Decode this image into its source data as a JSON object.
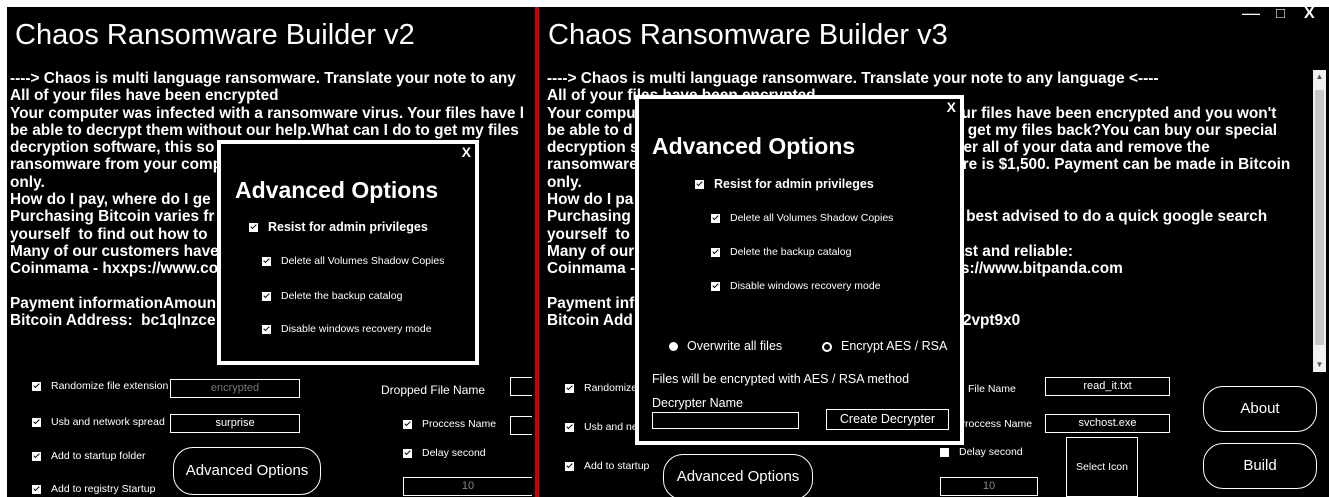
{
  "left": {
    "title": "Chaos Ransomware Builder v2",
    "note_lines": [
      "----> Chaos is multi language ransomware. Translate your note to any",
      "All of your files have been encrypted",
      "Your computer was infected with a ransomware virus. Your files have l",
      "be able to decrypt them without our help.What can I do to get my files",
      "decryption software, this so                                              f your c",
      "ransomware from your comp                                              $1,500.",
      "only.",
      "How do I pay, where do I ge",
      "Purchasing Bitcoin varies fr                                          t advise",
      "yourself  to find out how to",
      "Many of our customers have                                          d reliab",
      "Coinmama - hxxps://www.co                                          w.bitpar",
      "",
      "Payment informationAmoun",
      "Bitcoin Address:  bc1qlnzce                                          9x0"
    ],
    "options": {
      "randomize": "Randomize file extension",
      "usb": "Usb and network spread",
      "startup_folder": "Add to startup folder",
      "registry": "Add to registry Startup"
    },
    "extension_value": "encrypted",
    "spread_value": "surprise",
    "dropped_label": "Dropped File Name",
    "process_label": "Proccess Name",
    "delay_label": "Delay second",
    "delay_value": "10",
    "advanced_button": "Advanced Options",
    "modal": {
      "title": "Advanced Options",
      "close": "X",
      "resist": "Resist for admin privileges",
      "shadow": "Delete all Volumes Shadow Copies",
      "backup": "Delete the backup catalog",
      "recovery": "Disable windows recovery mode"
    }
  },
  "right": {
    "title": "Chaos Ransomware Builder v3",
    "window_controls": [
      "—",
      "□",
      "X"
    ],
    "note_lines": [
      "----> Chaos is multi language ransomware. Translate your note to any language <----",
      "All of your files have been encrypted",
      "Your compu                                                                          our files have been encrypted and you won't",
      "be able to d                                                                          to get my files back?You can buy our special",
      "decryption s                                                                          ver all of your data and remove the",
      "ransomware                                                                          are is $1,500. Payment can be made in Bitcoin",
      "only.",
      "How do I pa",
      "Purchasing                                                                          re best advised to do a quick google search",
      "yourself  to",
      "Many of our                                                                          fast and reliable:",
      "Coinmama -                                                                          ps://www.bitpanda.com",
      "",
      "Payment inf",
      "Bitcoin Add                                                                          6f2vpt9x0"
    ],
    "options": {
      "randomize": "Randomize",
      "usb": "Usb and ne",
      "startup": "Add to startup"
    },
    "file_name_label": "File Name",
    "file_name_value": "read_it.txt",
    "process_label": "Proccess Name",
    "process_value": "svchost.exe",
    "delay_label": "Delay second",
    "delay_value": "10",
    "select_icon": "Select Icon",
    "advanced_button": "Advanced Options",
    "about_button": "About",
    "build_button": "Build",
    "modal": {
      "title": "Advanced Options",
      "close": "X",
      "resist": "Resist for admin privileges",
      "shadow": "Delete all Volumes Shadow Copies",
      "backup": "Delete the backup catalog",
      "recovery": "Disable windows recovery mode",
      "overwrite": "Overwrite all files",
      "encrypt": "Encrypt  AES / RSA",
      "encrypt_note": "Files will be encrypted with AES / RSA method",
      "decrypter_label": "Decrypter Name",
      "create_decrypter": "Create Decrypter"
    }
  }
}
